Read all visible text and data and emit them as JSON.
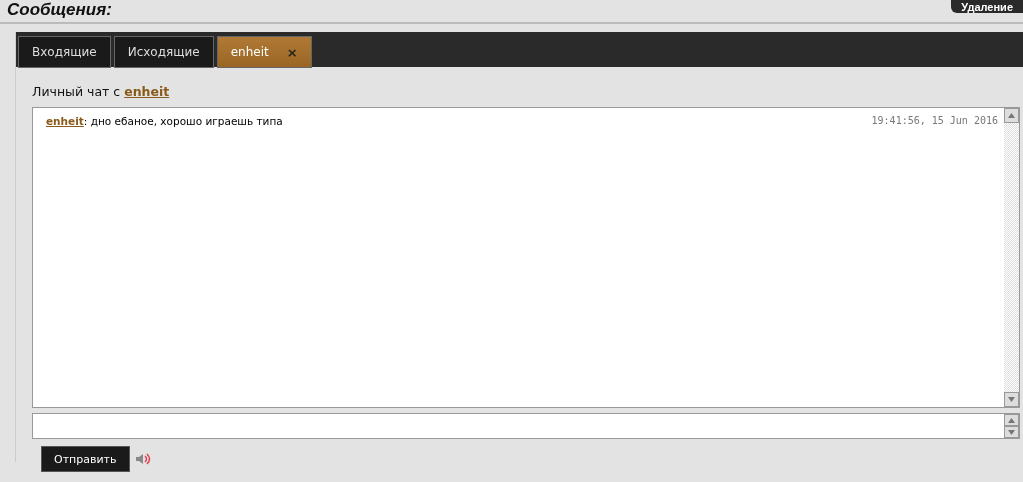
{
  "page": {
    "title": "Сообщения:",
    "delete_button": "Удаление"
  },
  "tabs": [
    {
      "label": "Входящие",
      "selected": false,
      "closable": false
    },
    {
      "label": "Исходящие",
      "selected": false,
      "closable": false
    },
    {
      "label": "enheit",
      "selected": true,
      "closable": true,
      "close": "×"
    }
  ],
  "chat": {
    "heading": "Личный чат с ",
    "partner": "enheit",
    "messages": [
      {
        "author": "enheit",
        "text": ": дно ебаное, хорошо играешь типа",
        "time": "19:41:56, 15 Jun 2016"
      }
    ]
  },
  "composer": {
    "send_button": "Отправить",
    "sound_on": true
  }
}
